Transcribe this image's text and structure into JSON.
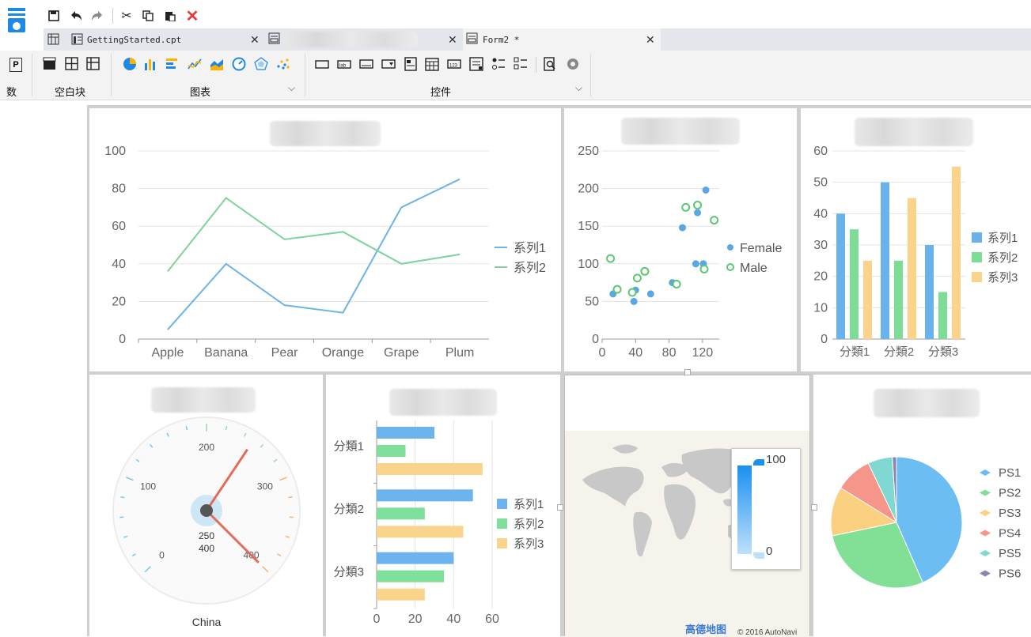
{
  "tabs": [
    {
      "label": "GettingStarted.cpt"
    },
    {
      "label": ""
    },
    {
      "label": "Form2 *"
    }
  ],
  "ribbon": {
    "group_left": "数",
    "group_left_icon": "P",
    "group_blank": "空白块",
    "group_chart": "图表",
    "group_controls": "控件"
  },
  "charts": {
    "line": {
      "type": "line",
      "categories": [
        "Apple",
        "Banana",
        "Pear",
        "Orange",
        "Grape",
        "Plum"
      ],
      "series": [
        {
          "name": "系列1",
          "values": [
            5,
            40,
            18,
            14,
            70,
            85
          ],
          "color": "#6cb3e8"
        },
        {
          "name": "系列2",
          "values": [
            36,
            75,
            53,
            57,
            40,
            45
          ],
          "color": "#7ed49a"
        }
      ],
      "yticks": [
        "0",
        "20",
        "40",
        "60",
        "80",
        "100"
      ],
      "ylim": [
        0,
        100
      ]
    },
    "scatter": {
      "type": "scatter",
      "xticks": [
        "0",
        "40",
        "80",
        "120"
      ],
      "yticks": [
        "0",
        "50",
        "100",
        "150",
        "200",
        "250"
      ],
      "xlim": [
        0,
        140
      ],
      "ylim": [
        0,
        250
      ],
      "series": [
        {
          "name": "Female",
          "color": "#5aa7e6",
          "points": [
            [
              13,
              60
            ],
            [
              38,
              50
            ],
            [
              40,
              65
            ],
            [
              58,
              60
            ],
            [
              84,
              75
            ],
            [
              96,
              148
            ],
            [
              112,
              100
            ],
            [
              114,
              168
            ],
            [
              121,
              100
            ],
            [
              124,
              198
            ]
          ]
        },
        {
          "name": "Male",
          "color": "#5cc870",
          "points": [
            [
              10,
              107
            ],
            [
              18,
              66
            ],
            [
              36,
              62
            ],
            [
              42,
              81
            ],
            [
              51,
              90
            ],
            [
              89,
              73
            ],
            [
              100,
              175
            ],
            [
              114,
              178
            ],
            [
              122,
              93
            ],
            [
              134,
              158
            ]
          ]
        }
      ]
    },
    "bar": {
      "type": "bar",
      "categories": [
        "分類1",
        "分類2",
        "分類3"
      ],
      "yticks": [
        "0",
        "10",
        "20",
        "30",
        "40",
        "50",
        "60"
      ],
      "ylim": [
        0,
        60
      ],
      "series": [
        {
          "name": "系列1",
          "values": [
            40,
            50,
            30
          ],
          "color": "#69b2ec"
        },
        {
          "name": "系列2",
          "values": [
            35,
            25,
            15
          ],
          "color": "#7edc96"
        },
        {
          "name": "系列3",
          "values": [
            25,
            45,
            55
          ],
          "color": "#fbd38a"
        }
      ]
    },
    "gauge": {
      "type": "gauge",
      "ticks": [
        "0",
        "100",
        "200",
        "300",
        "400"
      ],
      "value1": "250",
      "value2": "400",
      "label": "China"
    },
    "hbar": {
      "type": "bar",
      "orientation": "horizontal",
      "categories": [
        "分類1",
        "分類2",
        "分類3"
      ],
      "xticks": [
        "0",
        "20",
        "40",
        "60"
      ],
      "xlim": [
        0,
        60
      ],
      "series": [
        {
          "name": "系列1",
          "values": [
            30,
            50,
            40
          ],
          "color": "#6db4ee"
        },
        {
          "name": "系列2",
          "values": [
            15,
            25,
            35
          ],
          "color": "#7ee09a"
        },
        {
          "name": "系列3",
          "values": [
            55,
            45,
            25
          ],
          "color": "#fad38c"
        }
      ]
    },
    "map": {
      "legend_max": "100",
      "legend_min": "0",
      "attribution": "© 2016 AutoNavi",
      "brand": "高德地图"
    },
    "pie": {
      "type": "pie",
      "slices": [
        {
          "name": "PS1",
          "value": 43,
          "color": "#6cbdf2"
        },
        {
          "name": "PS2",
          "value": 28,
          "color": "#82df96"
        },
        {
          "name": "PS3",
          "value": 12,
          "color": "#fbd181"
        },
        {
          "name": "PS4",
          "value": 9,
          "color": "#f6958a"
        },
        {
          "name": "PS5",
          "value": 6,
          "color": "#7fd9d2"
        },
        {
          "name": "PS6",
          "value": 1,
          "color": "#8a86b3"
        }
      ]
    }
  }
}
